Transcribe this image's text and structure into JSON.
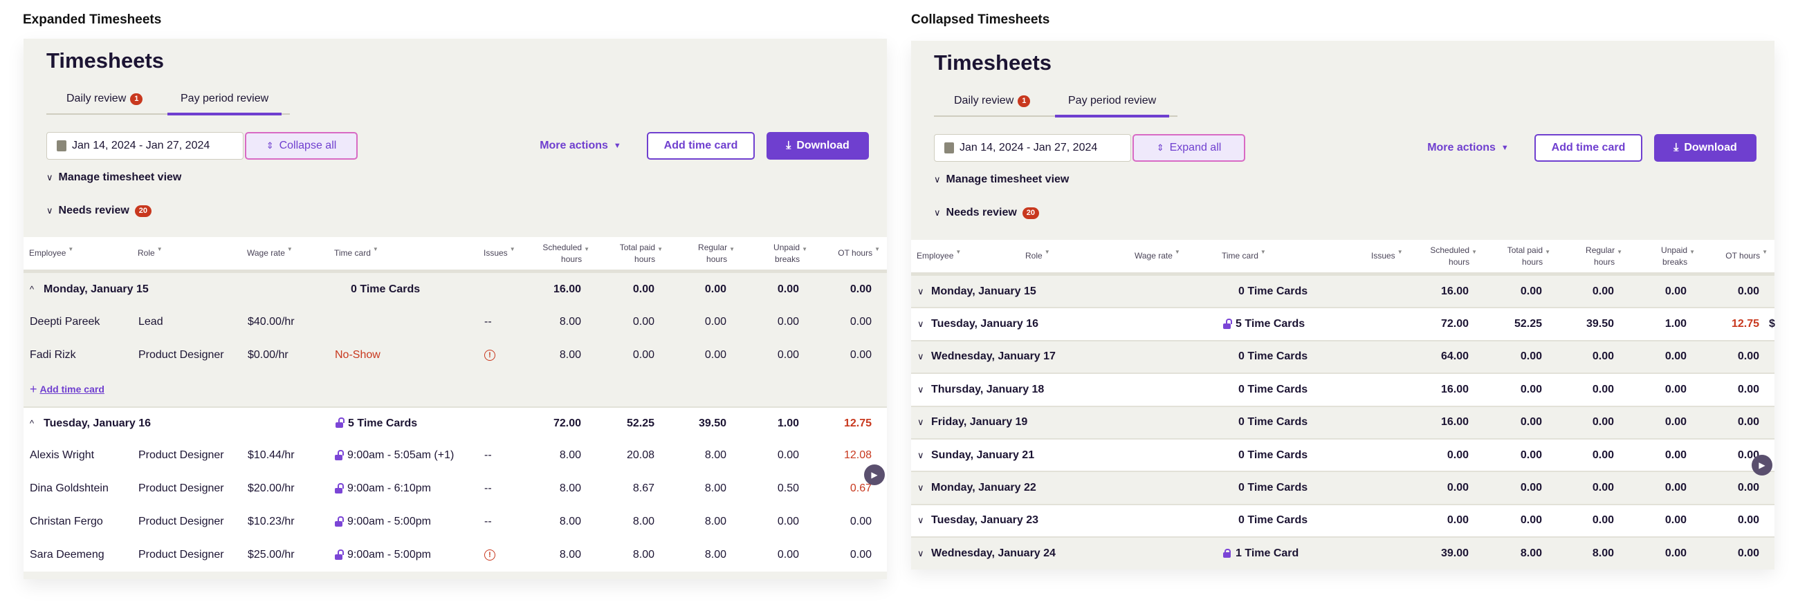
{
  "colors": {
    "accent": "#6f3fcf",
    "danger": "#c8381e",
    "panel_bg": "#f1f1ec",
    "text": "#1c1433"
  },
  "columns": [
    {
      "key": "employee",
      "label": "Employee"
    },
    {
      "key": "role",
      "label": "Role"
    },
    {
      "key": "wage",
      "label": "Wage rate"
    },
    {
      "key": "timecard",
      "label": "Time card"
    },
    {
      "key": "issues",
      "label": "Issues"
    },
    {
      "key": "scheduled",
      "label": "Scheduled hours"
    },
    {
      "key": "total",
      "label": "Total paid hours"
    },
    {
      "key": "regular",
      "label": "Regular hours"
    },
    {
      "key": "unpaid",
      "label": "Unpaid breaks"
    },
    {
      "key": "ot",
      "label": "OT hours"
    }
  ],
  "panels": [
    {
      "caption": "Expanded Timesheets",
      "title": "Timesheets",
      "tabs": [
        {
          "label": "Daily review",
          "badge": "1"
        },
        {
          "label": "Pay period review"
        }
      ],
      "date_range": "Jan 14, 2024 - Jan 27, 2024",
      "toggle_label": "Collapse all",
      "more_actions": "More actions",
      "add_time_card": "Add time card",
      "download": "Download",
      "manage_view": "Manage timesheet view",
      "needs_review": "Needs review",
      "needs_review_count": "20",
      "rows": [
        {
          "type": "group",
          "expanded": true,
          "bg": "grey",
          "label": "Monday, January 15",
          "timecard": "0 Time Cards",
          "lock": "none",
          "values": [
            "16.00",
            "0.00",
            "0.00",
            "0.00",
            "0.00"
          ],
          "ot_alert": false
        },
        {
          "type": "emp",
          "bg": "grey",
          "employee": "Deepti Pareek",
          "role": "Lead",
          "wage": "$40.00/hr",
          "timecard": "",
          "issues": "--",
          "values": [
            "8.00",
            "0.00",
            "0.00",
            "0.00",
            "0.00"
          ]
        },
        {
          "type": "emp",
          "bg": "grey",
          "employee": "Fadi Rizk",
          "role": "Product Designer",
          "wage": "$0.00/hr",
          "timecard": "No-Show",
          "timecard_alert": true,
          "issues": "warning",
          "values": [
            "8.00",
            "0.00",
            "0.00",
            "0.00",
            "0.00"
          ]
        },
        {
          "type": "add",
          "bg": "grey",
          "label": "Add time card"
        },
        {
          "type": "group",
          "expanded": true,
          "bg": "white",
          "label": "Tuesday, January 16",
          "timecard": "5 Time Cards",
          "lock": "open",
          "values": [
            "72.00",
            "52.25",
            "39.50",
            "1.00",
            "12.75"
          ],
          "ot_alert": true
        },
        {
          "type": "emp",
          "bg": "white",
          "employee": "Alexis Wright",
          "role": "Product Designer",
          "wage": "$10.44/hr",
          "timecard": "9:00am - 5:05am (+1)",
          "lock": "open",
          "issues": "--",
          "values": [
            "8.00",
            "20.08",
            "8.00",
            "0.00",
            "12.08"
          ],
          "ot_alert": true
        },
        {
          "type": "emp",
          "bg": "white",
          "employee": "Dina Goldshtein",
          "role": "Product Designer",
          "wage": "$20.00/hr",
          "timecard": "9:00am - 6:10pm",
          "lock": "open",
          "issues": "--",
          "values": [
            "8.00",
            "8.67",
            "8.00",
            "0.50",
            "0.67"
          ],
          "ot_alert": true
        },
        {
          "type": "emp",
          "bg": "white",
          "employee": "Christan Fergo",
          "role": "Product Designer",
          "wage": "$10.23/hr",
          "timecard": "9:00am - 5:00pm",
          "lock": "open",
          "issues": "--",
          "values": [
            "8.00",
            "8.00",
            "8.00",
            "0.00",
            "0.00"
          ]
        },
        {
          "type": "emp",
          "bg": "white",
          "employee": "Sara Deemeng",
          "role": "Product Designer",
          "wage": "$25.00/hr",
          "timecard": "9:00am - 5:00pm",
          "lock": "open",
          "issues": "warning",
          "values": [
            "8.00",
            "8.00",
            "8.00",
            "0.00",
            "0.00"
          ]
        }
      ]
    },
    {
      "caption": "Collapsed Timesheets",
      "title": "Timesheets",
      "tabs": [
        {
          "label": "Daily review",
          "badge": "1"
        },
        {
          "label": "Pay period review"
        }
      ],
      "date_range": "Jan 14, 2024 - Jan 27, 2024",
      "toggle_label": "Expand all",
      "more_actions": "More actions",
      "add_time_card": "Add time card",
      "download": "Download",
      "manage_view": "Manage timesheet view",
      "needs_review": "Needs review",
      "needs_review_count": "20",
      "overflow_text": "$",
      "rows": [
        {
          "type": "group",
          "expanded": false,
          "bg": "grey",
          "label": "Monday, January 15",
          "timecard": "0 Time Cards",
          "lock": "none",
          "values": [
            "16.00",
            "0.00",
            "0.00",
            "0.00",
            "0.00"
          ]
        },
        {
          "type": "group",
          "expanded": false,
          "bg": "white",
          "label": "Tuesday, January 16",
          "timecard": "5 Time Cards",
          "lock": "open",
          "values": [
            "72.00",
            "52.25",
            "39.50",
            "1.00",
            "12.75"
          ],
          "ot_alert": true,
          "overflow": true
        },
        {
          "type": "group",
          "expanded": false,
          "bg": "grey",
          "label": "Wednesday, January 17",
          "timecard": "0 Time Cards",
          "lock": "none",
          "values": [
            "64.00",
            "0.00",
            "0.00",
            "0.00",
            "0.00"
          ]
        },
        {
          "type": "group",
          "expanded": false,
          "bg": "white",
          "label": "Thursday, January 18",
          "timecard": "0 Time Cards",
          "lock": "none",
          "values": [
            "16.00",
            "0.00",
            "0.00",
            "0.00",
            "0.00"
          ]
        },
        {
          "type": "group",
          "expanded": false,
          "bg": "grey",
          "label": "Friday, January 19",
          "timecard": "0 Time Cards",
          "lock": "none",
          "values": [
            "16.00",
            "0.00",
            "0.00",
            "0.00",
            "0.00"
          ]
        },
        {
          "type": "group",
          "expanded": false,
          "bg": "white",
          "label": "Sunday, January 21",
          "timecard": "0 Time Cards",
          "lock": "none",
          "values": [
            "0.00",
            "0.00",
            "0.00",
            "0.00",
            "0.00"
          ]
        },
        {
          "type": "group",
          "expanded": false,
          "bg": "grey",
          "label": "Monday, January 22",
          "timecard": "0 Time Cards",
          "lock": "none",
          "values": [
            "0.00",
            "0.00",
            "0.00",
            "0.00",
            "0.00"
          ]
        },
        {
          "type": "group",
          "expanded": false,
          "bg": "white",
          "label": "Tuesday, January 23",
          "timecard": "0 Time Cards",
          "lock": "none",
          "values": [
            "0.00",
            "0.00",
            "0.00",
            "0.00",
            "0.00"
          ]
        },
        {
          "type": "group",
          "expanded": false,
          "bg": "grey",
          "label": "Wednesday, January 24",
          "timecard": "1 Time Card",
          "lock": "closed",
          "values": [
            "39.00",
            "8.00",
            "8.00",
            "0.00",
            "0.00"
          ]
        }
      ]
    }
  ]
}
